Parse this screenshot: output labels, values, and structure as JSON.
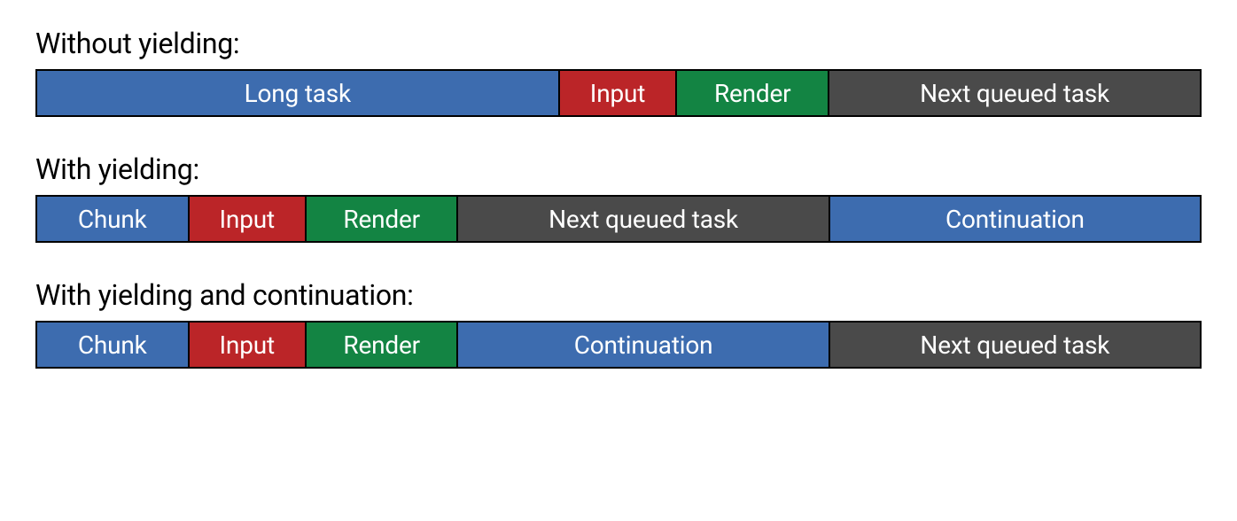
{
  "sections": [
    {
      "title": "Without yielding:",
      "segments": [
        {
          "label": "Long task",
          "color": "blue",
          "flex": 45
        },
        {
          "label": "Input",
          "color": "red",
          "flex": 10
        },
        {
          "label": "Render",
          "color": "green",
          "flex": 13
        },
        {
          "label": "Next queued task",
          "color": "gray",
          "flex": 32
        }
      ]
    },
    {
      "title": "With yielding:",
      "segments": [
        {
          "label": "Chunk",
          "color": "blue",
          "flex": 13
        },
        {
          "label": "Input",
          "color": "red",
          "flex": 10
        },
        {
          "label": "Render",
          "color": "green",
          "flex": 13
        },
        {
          "label": "Next queued task",
          "color": "gray",
          "flex": 32
        },
        {
          "label": "Continuation",
          "color": "blue",
          "flex": 32
        }
      ]
    },
    {
      "title": "With yielding and continuation:",
      "segments": [
        {
          "label": "Chunk",
          "color": "blue",
          "flex": 13
        },
        {
          "label": "Input",
          "color": "red",
          "flex": 10
        },
        {
          "label": "Render",
          "color": "green",
          "flex": 13
        },
        {
          "label": "Continuation",
          "color": "blue",
          "flex": 32
        },
        {
          "label": "Next queued task",
          "color": "gray",
          "flex": 32
        }
      ]
    }
  ]
}
